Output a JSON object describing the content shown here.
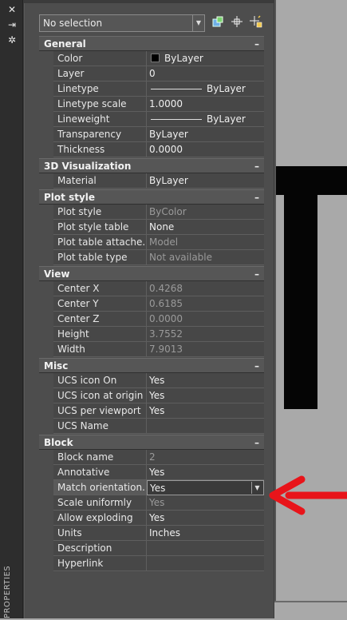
{
  "titlebar": {
    "vertical_title": "PROPERTIES",
    "icons": [
      "close-icon",
      "auto-hide-icon",
      "properties-icon"
    ]
  },
  "topbar": {
    "selection_value": "No selection",
    "buttons": [
      "toggle-pickadd-icon",
      "select-objects-icon",
      "quick-select-icon"
    ]
  },
  "sections": [
    {
      "title": "General",
      "collapse": "–",
      "rows": [
        {
          "label": "Color",
          "value": "ByLayer",
          "kind": "swatch",
          "swatch_color": "#000000"
        },
        {
          "label": "Layer",
          "value": "0"
        },
        {
          "label": "Linetype",
          "value": "ByLayer",
          "kind": "line"
        },
        {
          "label": "Linetype scale",
          "value": "1.0000"
        },
        {
          "label": "Lineweight",
          "value": "ByLayer",
          "kind": "line"
        },
        {
          "label": "Transparency",
          "value": "ByLayer"
        },
        {
          "label": "Thickness",
          "value": "0.0000"
        }
      ]
    },
    {
      "title": "3D Visualization",
      "collapse": "–",
      "rows": [
        {
          "label": "Material",
          "value": "ByLayer"
        }
      ]
    },
    {
      "title": "Plot style",
      "collapse": "–",
      "rows": [
        {
          "label": "Plot style",
          "value": "ByColor",
          "readonly": true
        },
        {
          "label": "Plot style table",
          "value": "None"
        },
        {
          "label": "Plot table attache...",
          "value": "Model",
          "readonly": true
        },
        {
          "label": "Plot table type",
          "value": "Not available",
          "readonly": true
        }
      ]
    },
    {
      "title": "View",
      "collapse": "–",
      "rows": [
        {
          "label": "Center X",
          "value": "0.4268",
          "readonly": true
        },
        {
          "label": "Center Y",
          "value": "0.6185",
          "readonly": true
        },
        {
          "label": "Center Z",
          "value": "0.0000",
          "readonly": true
        },
        {
          "label": "Height",
          "value": "3.7552",
          "readonly": true
        },
        {
          "label": "Width",
          "value": "7.9013",
          "readonly": true
        }
      ]
    },
    {
      "title": "Misc",
      "collapse": "–",
      "rows": [
        {
          "label": "UCS icon On",
          "value": "Yes"
        },
        {
          "label": "UCS icon at origin",
          "value": "Yes"
        },
        {
          "label": "UCS per viewport",
          "value": "Yes"
        },
        {
          "label": "UCS Name",
          "value": ""
        }
      ]
    },
    {
      "title": "Block",
      "collapse": "–",
      "rows": [
        {
          "label": "Block name",
          "value": "2",
          "readonly": true
        },
        {
          "label": "Annotative",
          "value": "Yes"
        },
        {
          "label": "Match  orientation...",
          "value": "Yes",
          "active": true
        },
        {
          "label": "Scale uniformly",
          "value": "Yes",
          "readonly": true
        },
        {
          "label": "Allow exploding",
          "value": "Yes"
        },
        {
          "label": "Units",
          "value": "Inches"
        },
        {
          "label": "Description",
          "value": ""
        },
        {
          "label": "Hyperlink",
          "value": ""
        }
      ]
    }
  ],
  "colors": {
    "annotation_arrow": "#e8141a",
    "drawing_geometry": "#050505"
  }
}
